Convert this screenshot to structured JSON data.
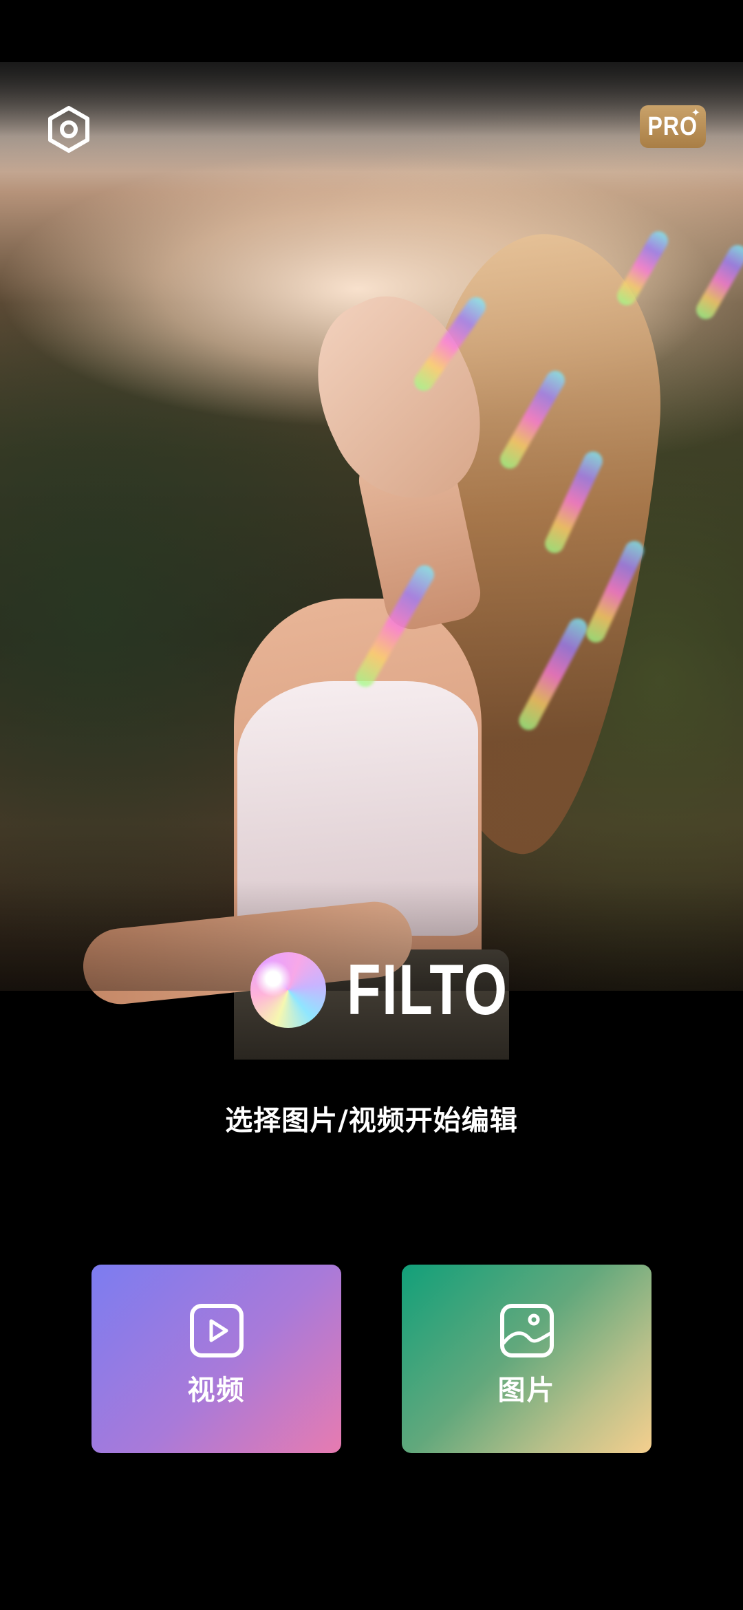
{
  "app": {
    "name": "FILTO"
  },
  "header": {
    "settings_icon": "settings-icon",
    "pro_badge": "PRO",
    "pro_badge_accent": "✦"
  },
  "hero": {
    "description": "background photo"
  },
  "main": {
    "subtitle": "选择图片/视频开始编辑"
  },
  "actions": [
    {
      "label": "视频",
      "icon": "play-icon",
      "gradient": [
        "#7c7cf0",
        "#e77bb0"
      ]
    },
    {
      "label": "图片",
      "icon": "image-icon",
      "gradient": [
        "#12a07a",
        "#f5cf8e"
      ]
    }
  ],
  "colors": {
    "background": "#000000",
    "pro_gold": "#b88c52",
    "text": "#ffffff"
  }
}
